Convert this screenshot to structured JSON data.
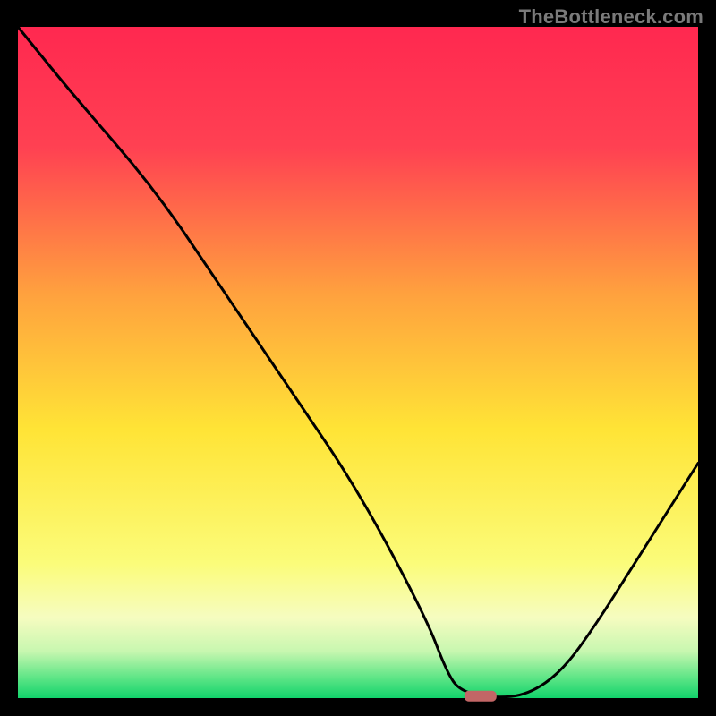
{
  "watermark": "TheBottleneck.com",
  "chart_data": {
    "type": "line",
    "title": "",
    "xlabel": "",
    "ylabel": "",
    "xlim": [
      0,
      100
    ],
    "ylim": [
      0,
      100
    ],
    "series": [
      {
        "name": "bottleneck-curve",
        "x": [
          0,
          8,
          20,
          30,
          40,
          50,
          60,
          63,
          65,
          70,
          75,
          80,
          85,
          90,
          95,
          100
        ],
        "values": [
          100,
          90,
          76,
          61,
          46,
          31,
          12,
          4,
          1,
          0,
          0.5,
          4,
          11,
          19,
          27,
          35
        ]
      }
    ],
    "marker": {
      "name": "highlight-point",
      "x": 68,
      "y": 0.3,
      "color": "#c26666"
    },
    "gradient_stops": [
      {
        "offset": 0,
        "color": "#ff2850"
      },
      {
        "offset": 18,
        "color": "#ff4152"
      },
      {
        "offset": 40,
        "color": "#ffa23e"
      },
      {
        "offset": 60,
        "color": "#ffe436"
      },
      {
        "offset": 80,
        "color": "#fbfc7a"
      },
      {
        "offset": 88,
        "color": "#f6fcc0"
      },
      {
        "offset": 93,
        "color": "#c8f7b0"
      },
      {
        "offset": 97,
        "color": "#5de586"
      },
      {
        "offset": 100,
        "color": "#12d36b"
      }
    ]
  }
}
